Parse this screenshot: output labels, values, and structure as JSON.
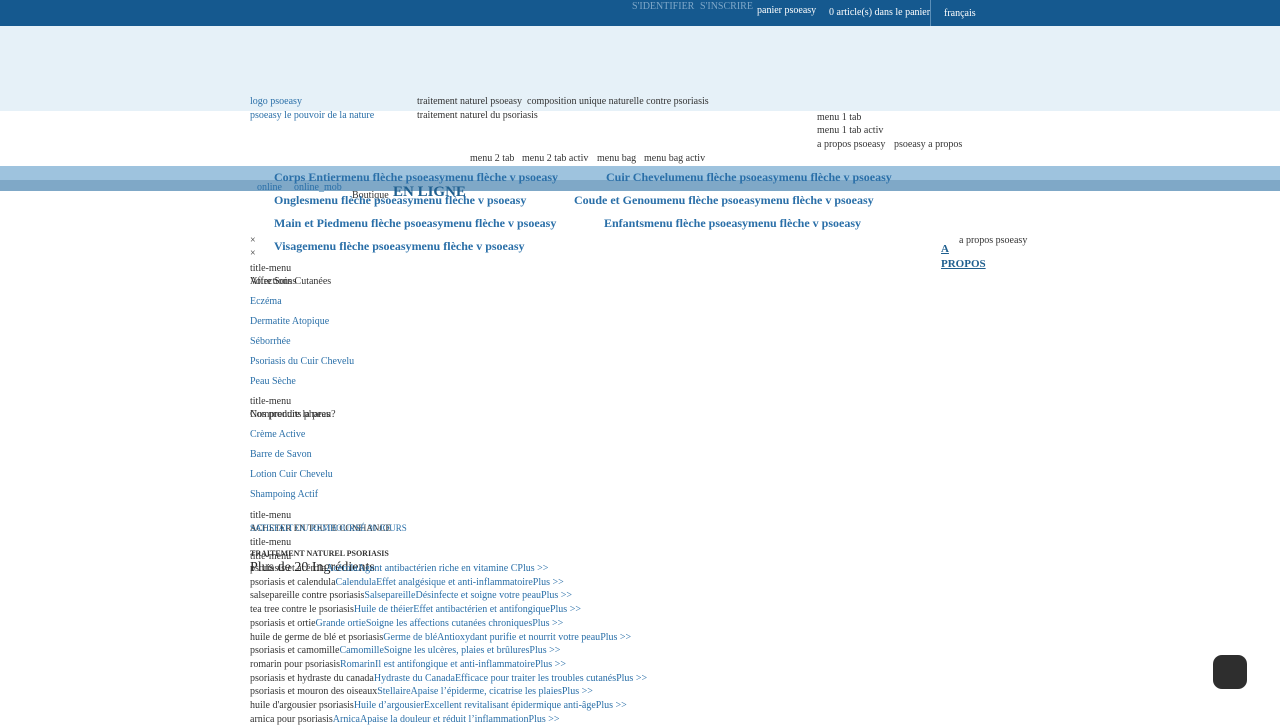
{
  "header": {
    "login": "S'IDENTIFIER",
    "register": "S'INSCRIRE",
    "cart_img_alt": "panier psoeasy",
    "cart_count": "0 article(s) dans le panier",
    "language_alt": "français"
  },
  "banner": {
    "logo_alt": "logo psoeasy",
    "tagline_alt": "psoeasy le pouvoir de la nature",
    "img1_alt": "traitement naturel psoeasy",
    "img2_alt": "composition unique naturelle contre psoriasis",
    "img3_alt": "traitement naturel du psoriasis",
    "menu1_tab": "menu 1 tab",
    "menu1_tab_active": "menu 1 tab activ",
    "apropos_alt1": "a propos psoeasy",
    "apropos_alt2": "psoeasy a propos"
  },
  "menu_tabs": {
    "menu2_tab": "menu 2 tab",
    "menu2_tab_active": "menu 2 tab activ",
    "menu_bag": "menu bag",
    "menu_bag_active": "menu bag activ"
  },
  "online": {
    "img1_alt": "online",
    "img2_alt": "online_mob",
    "boutique": "Boutique",
    "title": "EN LIGNE"
  },
  "arrows": {
    "right": "menu flèche psoeasy",
    "down": "menu flèche v psoeasy"
  },
  "nav": {
    "corps_entier": "Corps Entier",
    "cuir_chevelu": "Cuir Chevelu",
    "ongles": "Ongles",
    "coude_genou": "Coude et Genou",
    "main_pied": "Main et Pied",
    "enfants": "Enfants",
    "visage": "Visage",
    "apropos_line1": "A",
    "apropos_line2": "PROPOS",
    "apropos_img_alt": "a propos psoeasy"
  },
  "close_icons": [
    "×",
    "×"
  ],
  "sidebar": {
    "title_menu_alt": "title-menu",
    "section1_heading_a": "Affections Cutanées",
    "section1_heading_b": "Votre Soins",
    "section1_links": [
      "Eczéma",
      "Dermatite Atopique",
      "Séborrhée",
      "Psoriasis du Cuir Chevelu",
      "Peau Sèche"
    ],
    "section2_heading_a": "Comprendre la peau?",
    "section2_heading_b": "Nos produits phares",
    "section2_links": [
      "Crème Active",
      "Barre de Savon",
      "Lotion Cuir Chevelu",
      "Shampoing Actif"
    ],
    "section3_heading_a": "ACHETER EN TOUTE CONFIANCE",
    "section3_heading_b": "SATISFAIT OU REMBOURSÉ 30 JOURS",
    "section4_heading": "TRAITEMENT NATUREL PSORIASIS",
    "ingredients_title": "Plus de 20 Ingrédients"
  },
  "ingredients": [
    {
      "alt": "psoriasis et acérola",
      "name": "Acérola",
      "desc": "Agent antibactérien riche en vitamine C",
      "more": "Plus >>"
    },
    {
      "alt": "psoriasis et calendula",
      "name": "Calendula",
      "desc": "Effet analgésique et anti-inflammatoire",
      "more": "Plus >>"
    },
    {
      "alt": "salsepareille contre psoriasis",
      "name": "Salsepareille",
      "desc": "Désinfecte et soigne votre peau",
      "more": "Plus >>"
    },
    {
      "alt": "tea tree contre le psoriasis",
      "name": "Huile de théier",
      "desc": "Effet antibactérien et antifongique",
      "more": "Plus >>"
    },
    {
      "alt": "psoriasis et ortie",
      "name": "Grande ortie",
      "desc": "Soigne les affections cutanées chroniques",
      "more": "Plus >>"
    },
    {
      "alt": "huile de germe de blé et psoriasis",
      "name": "Germe de blé",
      "desc": "Antioxydant purifie et nourrit votre peau",
      "more": "Plus >>"
    },
    {
      "alt": "psoriasis et camomille",
      "name": "Camomille",
      "desc": "Soigne les ulcères, plaies et brûlures",
      "more": "Plus >>"
    },
    {
      "alt": "romarin pour psoriasis",
      "name": "Romarin",
      "desc": "Il est antifongique et anti-inflammatoire",
      "more": "Plus >>"
    },
    {
      "alt": "psoriasis et hydraste du canada",
      "name": "Hydraste du Canada",
      "desc": "Efficace pour traiter les troubles cutanés",
      "more": "Plus >>"
    },
    {
      "alt": "psoriasis et mouron des oiseaux",
      "name": "Stellaire",
      "desc": "Apaise l’épiderme, cicatrise les plaies",
      "more": "Plus >>"
    },
    {
      "alt": "huile d'argousier psoriasis",
      "name": "Huile d’argousier",
      "desc": "Excellent revitalisant épidermique anti-âge",
      "more": "Plus >>"
    },
    {
      "alt": "arnica pour psoriasis",
      "name": "Arnica",
      "desc": "Apaise la douleur et réduit l’inflammation",
      "more": "Plus >>"
    }
  ]
}
